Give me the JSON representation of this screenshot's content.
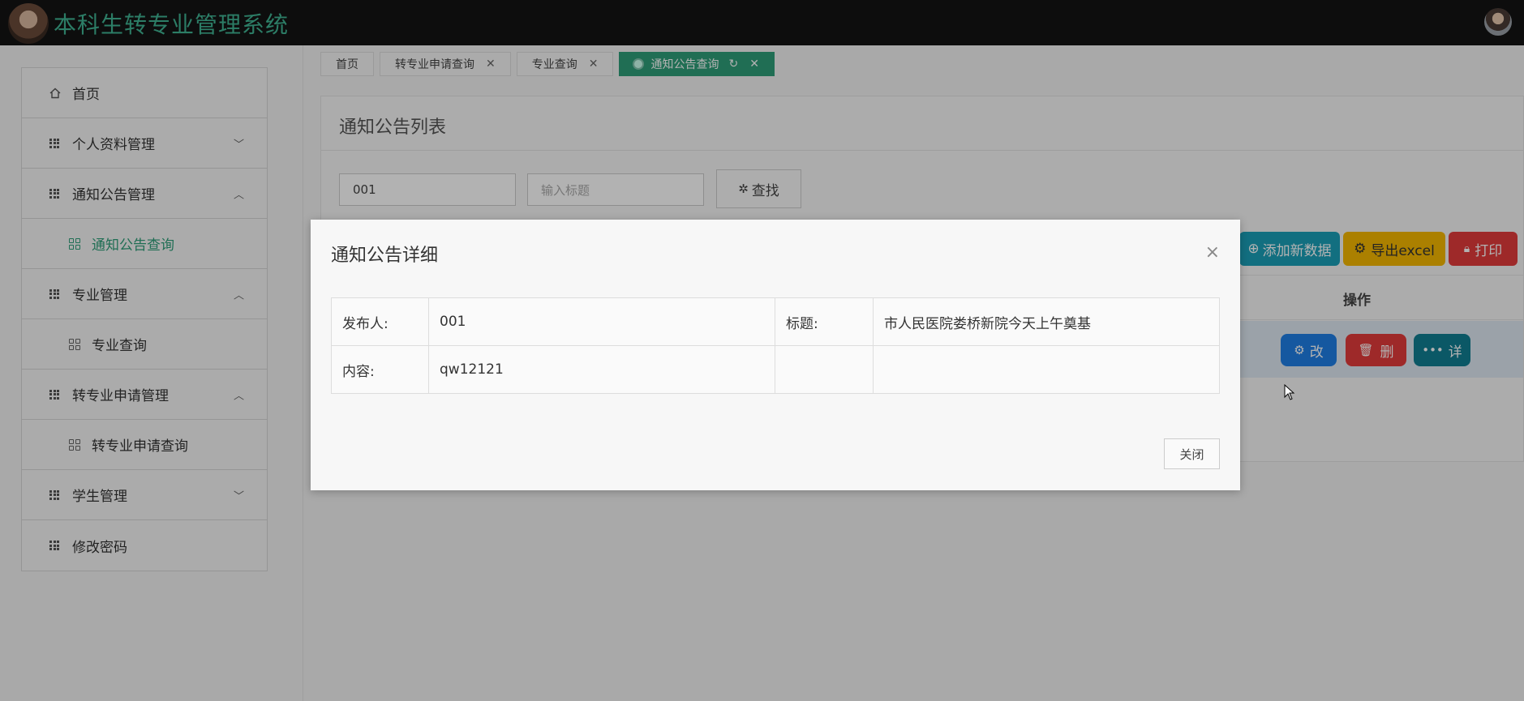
{
  "app": {
    "title": "本科生转专业管理系统"
  },
  "sidebar": {
    "items": [
      {
        "label": "首页",
        "icon": "home-icon"
      },
      {
        "label": "个人资料管理",
        "icon": "grid-icon",
        "expanded": false
      },
      {
        "label": "通知公告管理",
        "icon": "grid-icon",
        "expanded": true
      },
      {
        "label": "通知公告查询",
        "icon": "apps-icon",
        "sub": true,
        "active": true
      },
      {
        "label": "专业管理",
        "icon": "grid-icon",
        "expanded": true
      },
      {
        "label": "专业查询",
        "icon": "apps-icon",
        "sub": true
      },
      {
        "label": "转专业申请管理",
        "icon": "grid-icon",
        "expanded": true
      },
      {
        "label": "转专业申请查询",
        "icon": "apps-icon",
        "sub": true
      },
      {
        "label": "学生管理",
        "icon": "grid-icon",
        "expanded": false
      },
      {
        "label": "修改密码",
        "icon": "grid-icon"
      }
    ]
  },
  "tabs": [
    {
      "label": "首页"
    },
    {
      "label": "转专业申请查询"
    },
    {
      "label": "专业查询"
    },
    {
      "label": "通知公告查询",
      "active": true
    }
  ],
  "main": {
    "title": "通知公告列表",
    "search": {
      "publisher_value": "001",
      "title_placeholder": "输入标题",
      "button_label": "查找"
    },
    "actions": {
      "add": "添加新数据",
      "export": "导出excel",
      "print": "打印"
    },
    "table": {
      "ops_header": "操作",
      "row_buttons": {
        "edit": "改",
        "delete": "删",
        "detail": "详"
      }
    }
  },
  "modal": {
    "title": "通知公告详细",
    "fields": {
      "publisher_label": "发布人:",
      "publisher_value": "001",
      "title_label": "标题:",
      "title_value": "市人民医院娄桥新院今天上午奠基",
      "content_label": "内容:",
      "content_value": "qw12121"
    },
    "close_button": "关闭"
  },
  "colors": {
    "accent": "#2f9e79",
    "topbar": "#141414",
    "add_button": "#1aa0b8",
    "export_button": "#f5b800",
    "print_button": "#e33b3b",
    "edit_button": "#1f7fe5",
    "delete_button": "#e33b3b",
    "detail_button": "#117e93"
  }
}
